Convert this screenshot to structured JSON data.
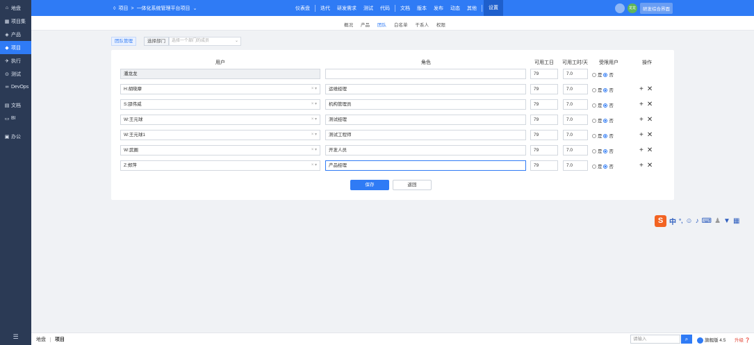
{
  "sidebar": {
    "items": [
      {
        "icon": "⌂",
        "label": "地盘"
      },
      {
        "icon": "▦",
        "label": "项目集"
      },
      {
        "icon": "◈",
        "label": "产品"
      },
      {
        "icon": "◆",
        "label": "项目"
      },
      {
        "icon": "✈",
        "label": "执行"
      },
      {
        "icon": "⊙",
        "label": "测试"
      },
      {
        "icon": "∞",
        "label": "DevOps"
      },
      {
        "icon": "▤",
        "label": "文档"
      },
      {
        "icon": "▭",
        "label": "BI"
      },
      {
        "icon": "▣",
        "label": "办公"
      }
    ],
    "menu_toggle": "☰"
  },
  "topbar": {
    "crumb_icon": "◊",
    "crumb_root": "项目",
    "crumb_sep": ">",
    "crumb_project": "一体化系统管理平台项目",
    "crumb_caret": "⌄",
    "nav": [
      "仪表盘",
      "迭代",
      "研发需求",
      "测试",
      "代码",
      "文档",
      "版本",
      "发布",
      "动态",
      "其他",
      "设置"
    ],
    "avatar_text": "龙龙",
    "dev_button": "研发综合界面"
  },
  "subnav": {
    "items": [
      "概况",
      "产品",
      "团队",
      "白名单",
      "干系人",
      "权限"
    ],
    "active": "团队"
  },
  "toolbar": {
    "team_tag": "团队管理",
    "dept_tag": "选择部门",
    "member_placeholder": "选择一个部门的成员"
  },
  "table": {
    "headers": {
      "user": "用户",
      "role": "角色",
      "days": "可用工日",
      "hours": "可用工时/天",
      "limited": "受限用户",
      "ops": "操作"
    },
    "yes_label": "是",
    "no_label": "否",
    "add_icon": "+",
    "del_icon": "✕",
    "rows": [
      {
        "user": "潘龙龙",
        "role": "",
        "days": "79",
        "hours": "7.0"
      },
      {
        "user": "H:胡晓摩",
        "role": "运维经理",
        "days": "79",
        "hours": "7.0"
      },
      {
        "user": "S:邵伟威",
        "role": "机构管理员",
        "days": "79",
        "hours": "7.0"
      },
      {
        "user": "W:王元球",
        "role": "测试经理",
        "days": "79",
        "hours": "7.0"
      },
      {
        "user": "W:王元球1",
        "role": "测试工程师",
        "days": "79",
        "hours": "7.0"
      },
      {
        "user": "W:武圈",
        "role": "开发人员",
        "days": "79",
        "hours": "7.0"
      },
      {
        "user": "Z:郑萍",
        "role": "产品经理",
        "days": "79",
        "hours": "7.0"
      }
    ]
  },
  "actions": {
    "save": "保存",
    "back": "返回"
  },
  "ime": {
    "logo": "S",
    "mode": "中",
    "punct": "°,"
  },
  "bottombar": {
    "home": "地盘",
    "current": "项目",
    "search_placeholder": "请输入",
    "version": "旗舰版 4.5",
    "upgrade": "升级"
  }
}
